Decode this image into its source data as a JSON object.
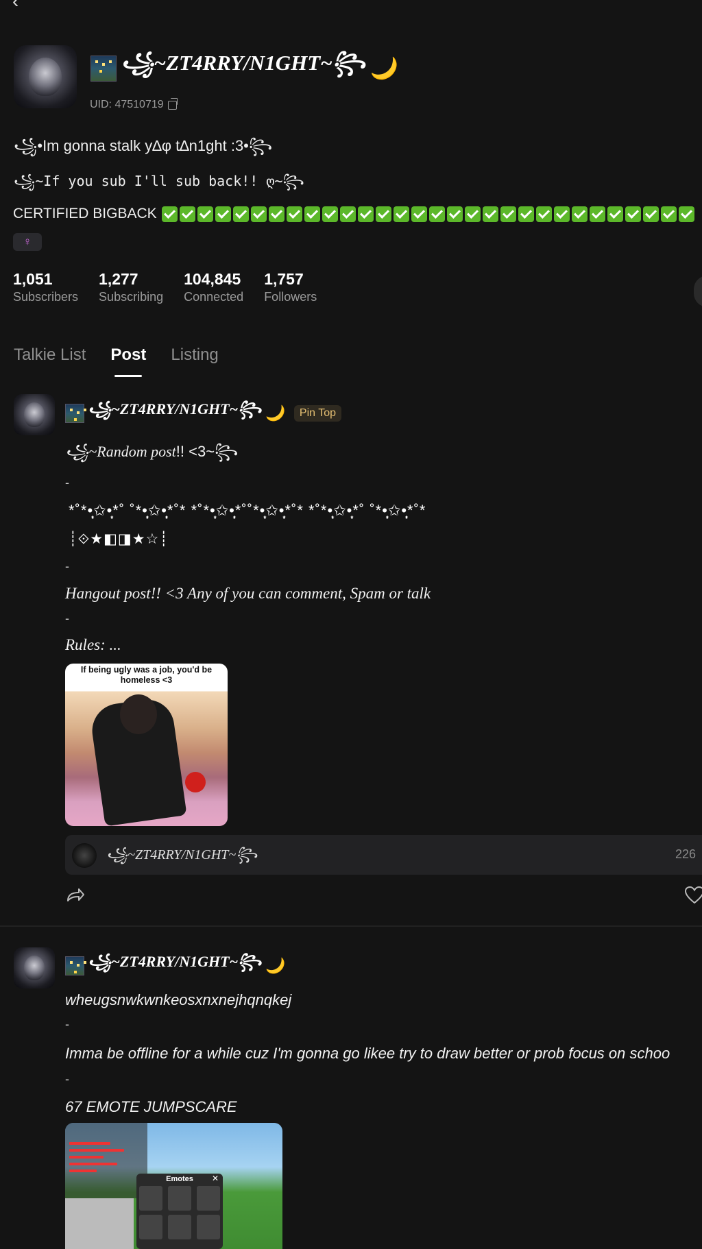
{
  "nav": {
    "back_glyph": "‹"
  },
  "profile": {
    "flag_emoji": "🌃",
    "name": "꧁~ZT4RRY/N1GHT~꧂",
    "moon_emoji": "🌙",
    "uid_label": "UID: 47510719",
    "bio_line1": "꧁•Im gonna stalk y∆φ t∆n1ght :3•꧂",
    "bio_line2": "꧁~If you sub I'll sub back!! ღ~꧂",
    "bio_line3": "CERTIFIED BIGBACK",
    "checkmark_count": 30,
    "gender_symbol": "♀",
    "stats": [
      {
        "value": "1,051",
        "label": "Subscribers"
      },
      {
        "value": "1,277",
        "label": "Subscribing"
      },
      {
        "value": "104,845",
        "label": "Connected"
      },
      {
        "value": "1,757",
        "label": "Followers"
      }
    ]
  },
  "tabs": [
    {
      "label": "Talkie List",
      "active": false
    },
    {
      "label": "Post",
      "active": true
    },
    {
      "label": "Listing",
      "active": false
    }
  ],
  "post1": {
    "author": "꧁~ZT4RRY/N1GHT~꧂",
    "pin_label": "Pin Top",
    "title_script": "꧁~Random post",
    "title_rest": "!! <3~꧂",
    "dash": "-",
    "stars_line1": "*˚*•̩̩͙✩•̩̩͙*˚ ˚*•̩̩͙✩•̩̩͙*˚* *˚*•̩̩͙✩•̩̩͙*˚˚*•̩̩͙✩•̩̩͙*˚* *˚*•̩̩͙✩•̩̩͙*˚ ˚*•̩̩͙✩•̩̩͙*˚*",
    "stars_line2": "┊⟐★◧◨★☆┊",
    "hangout": "Hangout post!! <3 Any of you can comment, Spam or talk",
    "rules": "Rules: ...",
    "meme_caption": "If being ugly was a job, you'd be homeless <3",
    "music_name": "꧁~ZT4RRY/N1GHT~꧂",
    "music_count": "226"
  },
  "post2": {
    "author": "꧁~ZT4RRY/N1GHT~꧂",
    "line1": "wheugsnwkwnkeosxnxnejhqnqkej",
    "dash": "-",
    "line2": "Imma be offline for a while cuz I'm gonna go likee try to draw better or prob focus on schoo",
    "line3": "67 EMOTE JUMPSCARE",
    "emotes_title": "Emotes",
    "emotes_close": "✕"
  },
  "colors": {
    "background": "#141414",
    "pin_gold": "#e6c073",
    "gender_pink": "#d06be0",
    "check_green": "#5cb82a"
  }
}
